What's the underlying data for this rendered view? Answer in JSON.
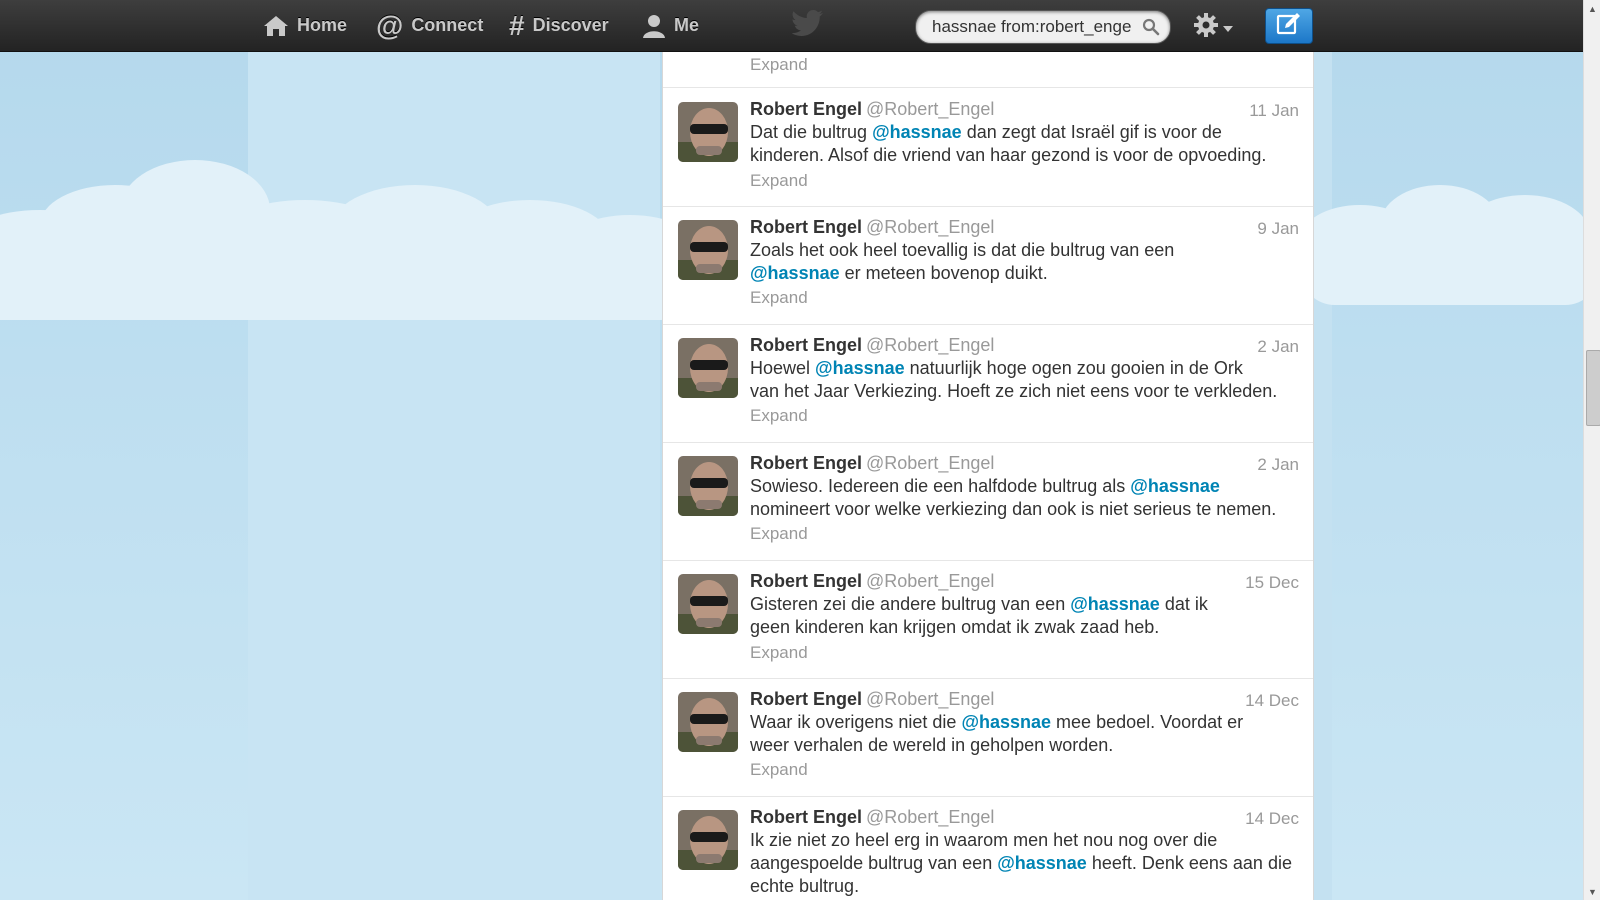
{
  "nav": {
    "home": "Home",
    "connect": "Connect",
    "discover": "Discover",
    "me": "Me"
  },
  "search": {
    "value": "hassnae from:robert_enge"
  },
  "icons": {
    "home": "home-icon",
    "connect": "at-icon",
    "discover": "hash-icon",
    "me": "person-icon",
    "logo": "twitter-bird-icon",
    "search": "magnifier-icon",
    "settings": "gear-icon",
    "compose": "compose-icon"
  },
  "colors": {
    "mention": "#0084b4",
    "compose": "#1c77c8",
    "topbar": "#2d2d2d"
  },
  "partial_expand": "Expand",
  "tweets": [
    {
      "name": "Robert Engel",
      "handle": "@Robert_Engel",
      "time": "11 Jan",
      "l1a": "Dat die bultrug ",
      "l1m": "@hassnae",
      "l1b": " dan zegt dat Israël gif is voor de",
      "l2": "kinderen. Alsof die vriend van haar gezond is voor de opvoeding.",
      "expand": "Expand"
    },
    {
      "name": "Robert Engel",
      "handle": "@Robert_Engel",
      "time": "9 Jan",
      "l1": "Zoals het ook heel toevallig is dat die bultrug van een",
      "l2m": "@hassnae",
      "l2b": " er meteen bovenop duikt.",
      "expand": "Expand"
    },
    {
      "name": "Robert Engel",
      "handle": "@Robert_Engel",
      "time": "2 Jan",
      "l1a": "Hoewel ",
      "l1m": "@hassnae",
      "l1b": " natuurlijk hoge ogen zou gooien in de Ork",
      "l2": "van het Jaar Verkiezing. Hoeft ze zich niet eens voor te verkleden.",
      "expand": "Expand"
    },
    {
      "name": "Robert Engel",
      "handle": "@Robert_Engel",
      "time": "2 Jan",
      "l1a": "Sowieso. Iedereen die een halfdode bultrug als ",
      "l1m": "@hassnae",
      "l2": "nomineert voor welke verkiezing dan ook is niet serieus te nemen.",
      "expand": "Expand"
    },
    {
      "name": "Robert Engel",
      "handle": "@Robert_Engel",
      "time": "15 Dec",
      "l1a": "Gisteren zei die andere bultrug van een ",
      "l1m": "@hassnae",
      "l1b": " dat ik",
      "l2": "geen kinderen kan krijgen omdat ik zwak zaad heb.",
      "expand": "Expand"
    },
    {
      "name": "Robert Engel",
      "handle": "@Robert_Engel",
      "time": "14 Dec",
      "l1a": "Waar ik overigens niet die ",
      "l1m": "@hassnae",
      "l1b": " mee bedoel. Voordat er",
      "l2": "weer verhalen de wereld in geholpen worden.",
      "expand": "Expand"
    },
    {
      "name": "Robert Engel",
      "handle": "@Robert_Engel",
      "time": "14 Dec",
      "l1": "Ik zie niet zo heel erg in waarom men het nou nog over die",
      "l2a": "aangespoelde bultrug van een ",
      "l2m": "@hassnae",
      "l2b": " heeft. Denk eens aan die",
      "l3": "echte bultrug."
    }
  ]
}
